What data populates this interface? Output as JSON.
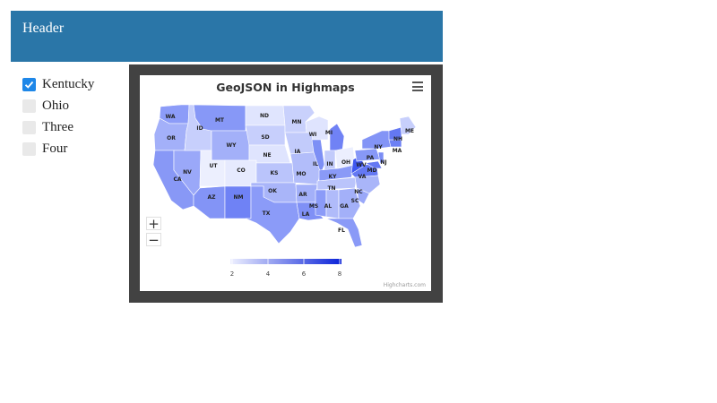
{
  "header": {
    "title": "Header"
  },
  "checkboxes": [
    {
      "label": "Kentucky",
      "checked": true
    },
    {
      "label": "Ohio",
      "checked": false
    },
    {
      "label": "Three",
      "checked": false
    },
    {
      "label": "Four",
      "checked": false
    }
  ],
  "chart": {
    "title": "GeoJSON in Highmaps",
    "credits": "Highcharts.com",
    "menu_icon": "hamburger-icon",
    "zoom_in_symbol": "+",
    "zoom_out_symbol": "−",
    "color_axis": {
      "min": 2,
      "max": 8,
      "ticks": [
        "2",
        "4",
        "6",
        "8"
      ],
      "min_color": "#eef0ff",
      "max_color": "#0a22d8"
    },
    "state_labels": [
      "WA",
      "OR",
      "ID",
      "MT",
      "ND",
      "MN",
      "WI",
      "MI",
      "ME",
      "NH",
      "NY",
      "MA",
      "SD",
      "WY",
      "NE",
      "IA",
      "IL",
      "IN",
      "OH",
      "PA",
      "NJ",
      "MD",
      "CA",
      "NV",
      "UT",
      "CO",
      "KS",
      "MO",
      "KY",
      "VA",
      "WV",
      "AZ",
      "NM",
      "OK",
      "AR",
      "TN",
      "NC",
      "SC",
      "TX",
      "MS",
      "AL",
      "GA",
      "LA",
      "FL"
    ]
  }
}
